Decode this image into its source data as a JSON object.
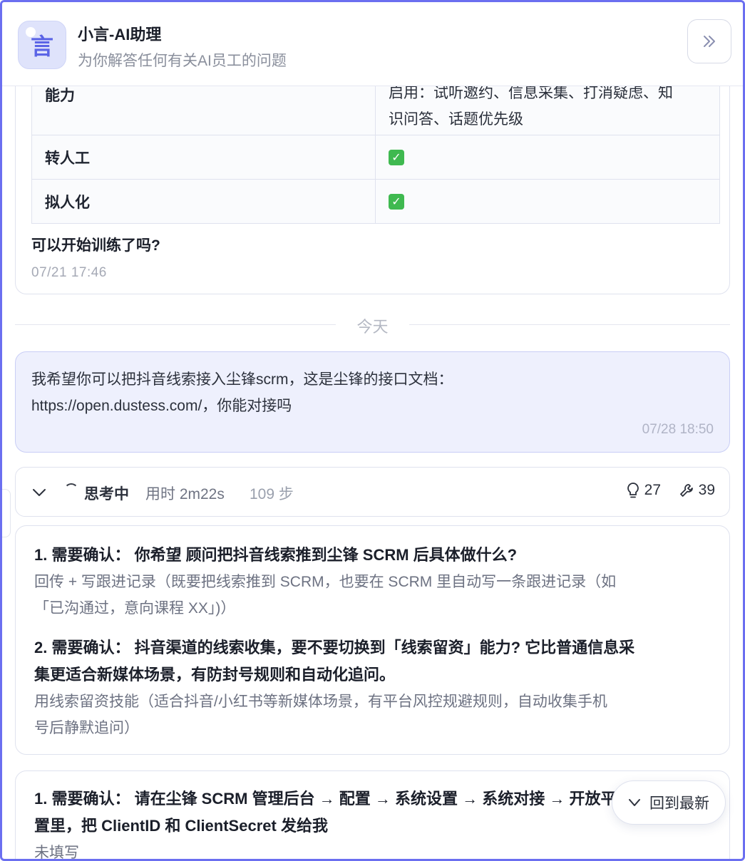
{
  "header": {
    "avatar_glyph": "言",
    "title": "小言-AI助理",
    "subtitle": "为你解答任何有关AI员工的问题"
  },
  "table": {
    "partial_row": {
      "label": "能力",
      "value_line1": "启用：试听邀约、信息采集、打消疑虑、知",
      "value_line2": "识问答、话题优先级"
    },
    "rows": [
      {
        "label": "转人工",
        "value": "✓"
      },
      {
        "label": "拟人化",
        "value": "✓"
      }
    ]
  },
  "prev_message": {
    "question": "可以开始训练了吗?",
    "timestamp": "07/21 17:46"
  },
  "divider_label": "今天",
  "user_message": {
    "line1": "我希望你可以把抖音线索接入尘锋scrm，这是尘锋的接口文档：",
    "line2": "https://open.dustess.com/，你能对接吗",
    "timestamp": "07/28 18:50"
  },
  "thinking": {
    "label": "思考中",
    "duration": "用时 2m22s",
    "steps": "109 步",
    "ideas_count": "27",
    "tools_count": "39"
  },
  "qa_block_1": {
    "q1_line1": "1. 需要确认： 你希望 顾问把抖音线索推到尘锋 SCRM 后具体做什么?",
    "a1_line1": "回传 + 写跟进记录（既要把线索推到 SCRM，也要在 SCRM 里自动写一条跟进记录（如",
    "a1_line2": "「已沟通过，意向课程 XX」)）",
    "q2_line1": "2. 需要确认： 抖音渠道的线索收集，要不要切换到「线索留资」能力? 它比普通信息采",
    "q2_line2": "集更适合新媒体场景，有防封号规则和自动化追问。",
    "a2_line1": "用线索留资技能（适合抖音/小红书等新媒体场景，有平台风控规避规则，自动收集手机",
    "a2_line2": "号后静默追问）"
  },
  "qa_block_2": {
    "q1_line1": "1. 需要确认： 请在尘锋 SCRM 管理后台 → 配置 → 系统设置 → 系统对接 → 开放平台配",
    "q1_line2": "置里，把 ClientID 和 ClientSecret 发给我",
    "a1_line1": "未填写"
  },
  "back_to_latest": "回到最新"
}
